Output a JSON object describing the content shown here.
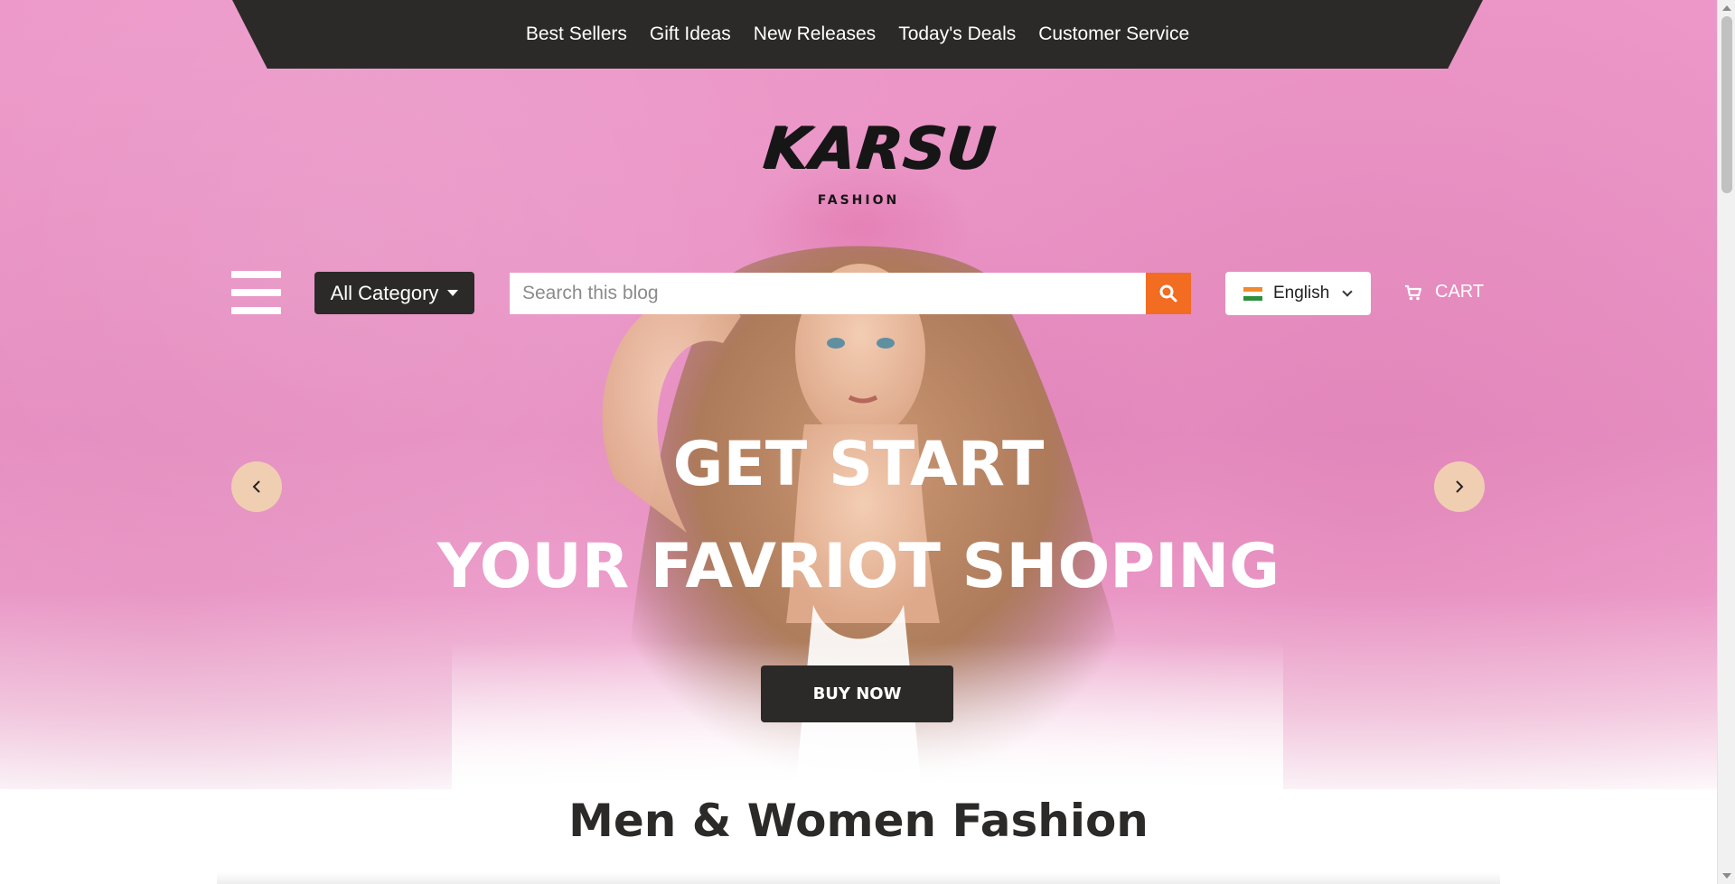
{
  "topnav": {
    "links": [
      "Best Sellers",
      "Gift Ideas",
      "New Releases",
      "Today's Deals",
      "Customer Service"
    ]
  },
  "logo": {
    "main": "KARSU",
    "sub": "FASHION"
  },
  "toolbar": {
    "menu_icon": "hamburger-icon",
    "category_label": "All Category",
    "search_placeholder": "Search this blog",
    "search_icon": "search-icon",
    "language": "English",
    "language_flag": "india-flag-icon",
    "cart_icon": "cart-icon",
    "cart_label": "CART"
  },
  "hero": {
    "headline_1": "GET START",
    "headline_2": "YOUR FAVRIOT SHOPING",
    "cta_label": "BUY NOW",
    "prev_icon": "chevron-left-icon",
    "next_icon": "chevron-right-icon"
  },
  "section": {
    "title": "Men & Women Fashion"
  },
  "colors": {
    "dark": "#2b2a28",
    "accent": "#f26c22",
    "hero_pink": "#ec97c8",
    "arrow_bg": "#f0ceb2"
  }
}
